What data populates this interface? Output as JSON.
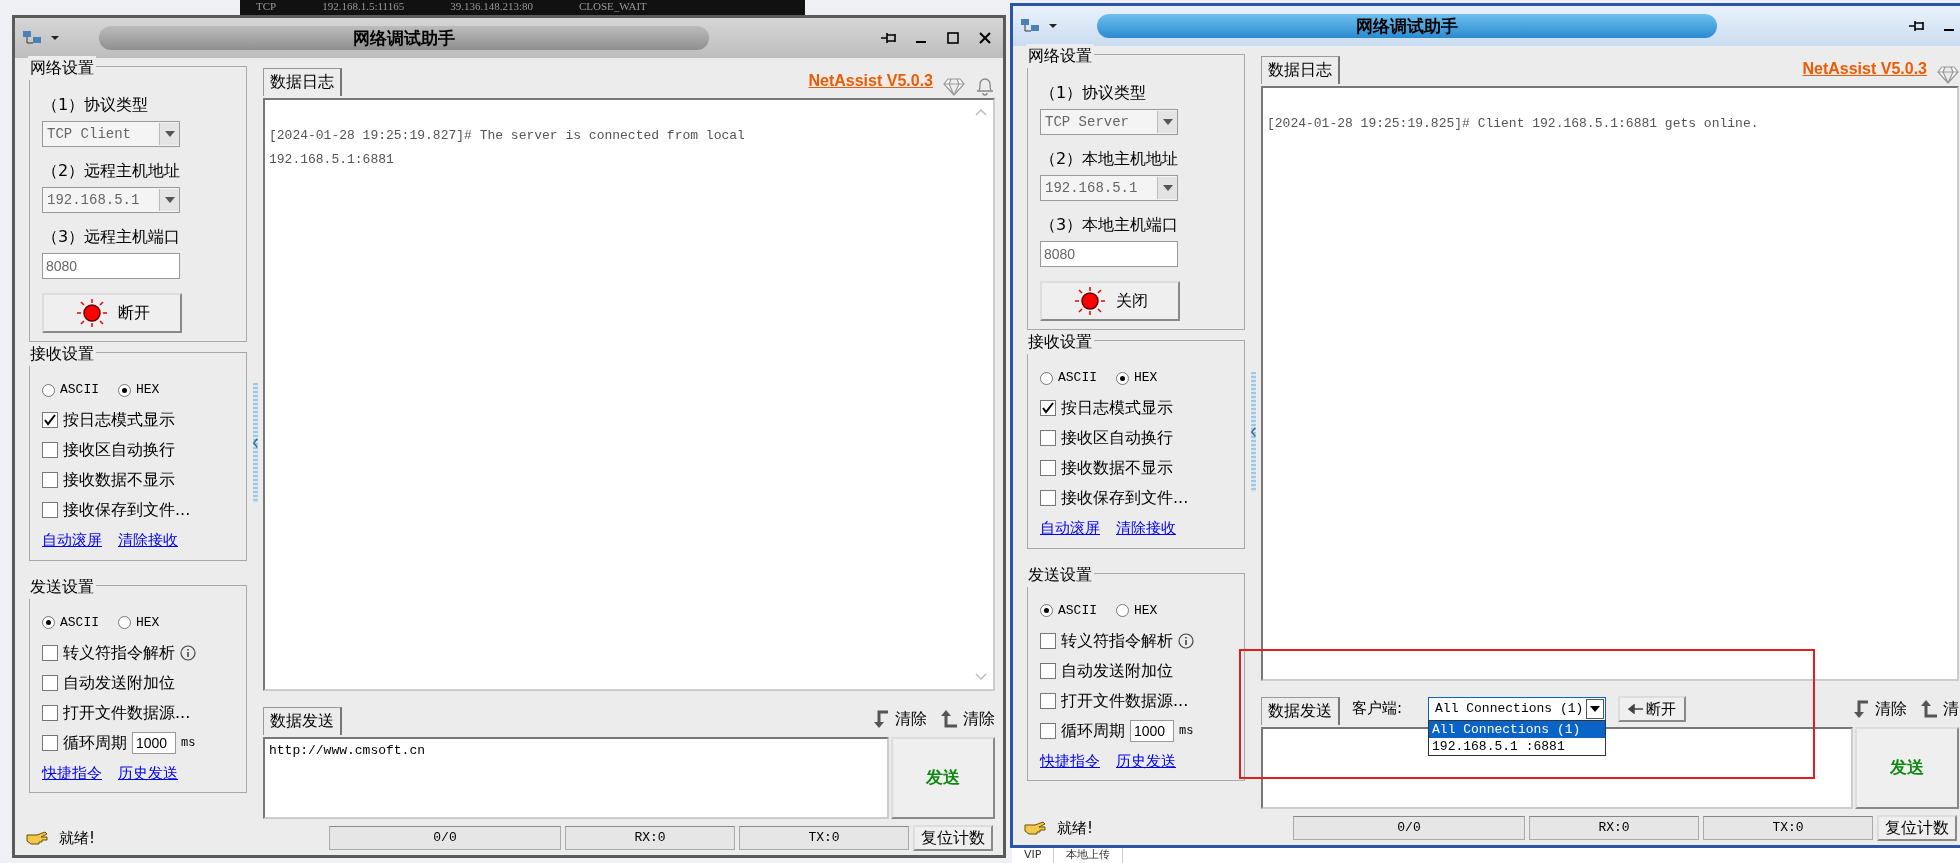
{
  "background": {
    "top_strip": [
      "TCP",
      "192.168.1.5:11165",
      "39.136.148.213:80",
      "CLOSE_WAIT"
    ],
    "bottom_strip": [
      "VIP",
      "本地上传"
    ]
  },
  "windows": [
    {
      "title": "网络调试助手",
      "active": false,
      "title_buttons": [
        {
          "kind": "pin"
        },
        {
          "kind": "minimize"
        },
        {
          "kind": "maximize"
        },
        {
          "kind": "close"
        }
      ],
      "network": {
        "title": "网络设置",
        "fields": [
          {
            "label": "（1）协议类型",
            "kind": "combo",
            "value": "TCP Client"
          },
          {
            "label": "（2）远程主机地址",
            "kind": "combo",
            "value": "192.168.5.1"
          },
          {
            "label": "（3）远程主机端口",
            "kind": "input",
            "value": "8080"
          }
        ],
        "button": "断开"
      },
      "receive": {
        "title": "接收设置",
        "options": [
          {
            "label": "ASCII",
            "selected": false
          },
          {
            "label": "HEX",
            "selected": true
          }
        ],
        "checks": [
          {
            "label": "按日志模式显示",
            "checked": true
          },
          {
            "label": "接收区自动换行",
            "checked": false
          },
          {
            "label": "接收数据不显示",
            "checked": false
          },
          {
            "label": "接收保存到文件...",
            "checked": false
          }
        ],
        "links": [
          "自动滚屏",
          "清除接收"
        ]
      },
      "send_settings": {
        "title": "发送设置",
        "options": [
          {
            "label": "ASCII",
            "selected": true
          },
          {
            "label": "HEX",
            "selected": false
          }
        ],
        "checks": [
          {
            "label": "转义符指令解析",
            "checked": false,
            "info": true
          },
          {
            "label": "自动发送附加位",
            "checked": false
          },
          {
            "label": "打开文件数据源...",
            "checked": false
          },
          {
            "label": "循环周期",
            "checked": false,
            "period": "1000",
            "unit": "ms"
          }
        ],
        "links": [
          "快捷指令",
          "历史发送"
        ]
      },
      "log_tab": "数据日志",
      "brand": "NetAssist V5.0.3",
      "header_icons": [
        {
          "kind": "diamond"
        },
        {
          "kind": "bell"
        }
      ],
      "log_scroll_arrows": true,
      "log_lines": [
        "[2024-01-28 19:25:19.827]# The server is connected from local",
        "192.168.5.1:6881"
      ],
      "send_tab": "数据发送",
      "clear_buttons": [
        "清除",
        "清除"
      ],
      "send_text": "http://www.cmsoft.cn",
      "send_button": "发送",
      "status": {
        "ready": "就绪!",
        "counts": [
          "0/0",
          "RX:0",
          "TX:0"
        ],
        "reset": "复位计数"
      }
    },
    {
      "title": "网络调试助手",
      "active": true,
      "title_buttons": [
        {
          "kind": "pin"
        },
        {
          "kind": "minimize"
        }
      ],
      "network": {
        "title": "网络设置",
        "fields": [
          {
            "label": "（1）协议类型",
            "kind": "combo",
            "value": "TCP Server"
          },
          {
            "label": "（2）本地主机地址",
            "kind": "combo",
            "value": "192.168.5.1"
          },
          {
            "label": "（3）本地主机端口",
            "kind": "input",
            "value": "8080"
          }
        ],
        "button": "关闭"
      },
      "receive": {
        "title": "接收设置",
        "options": [
          {
            "label": "ASCII",
            "selected": false
          },
          {
            "label": "HEX",
            "selected": true
          }
        ],
        "checks": [
          {
            "label": "按日志模式显示",
            "checked": true
          },
          {
            "label": "接收区自动换行",
            "checked": false
          },
          {
            "label": "接收数据不显示",
            "checked": false
          },
          {
            "label": "接收保存到文件...",
            "checked": false
          }
        ],
        "links": [
          "自动滚屏",
          "清除接收"
        ]
      },
      "send_settings": {
        "title": "发送设置",
        "options": [
          {
            "label": "ASCII",
            "selected": true
          },
          {
            "label": "HEX",
            "selected": false
          }
        ],
        "checks": [
          {
            "label": "转义符指令解析",
            "checked": false,
            "info": true
          },
          {
            "label": "自动发送附加位",
            "checked": false
          },
          {
            "label": "打开文件数据源...",
            "checked": false
          },
          {
            "label": "循环周期",
            "checked": false,
            "period": "1000",
            "unit": "ms"
          }
        ],
        "links": [
          "快捷指令",
          "历史发送"
        ]
      },
      "log_tab": "数据日志",
      "brand": "NetAssist V5.0.3",
      "header_icons": [
        {
          "kind": "diamond"
        }
      ],
      "log_scroll_arrows": false,
      "log_lines": [
        "[2024-01-28 19:25:19.825]# Client 192.168.5.1:6881 gets online."
      ],
      "send_tab": "数据发送",
      "client_selector": {
        "label": "客户端:",
        "value": "All Connections (1)",
        "disconnect": "断开",
        "expanded": true,
        "options": [
          {
            "label": "All Connections (1)",
            "selected": true
          },
          {
            "label": "192.168.5.1 :6881",
            "selected": false
          }
        ]
      },
      "clear_buttons": [
        "清除",
        "清"
      ],
      "send_button": "发送",
      "annotation": true,
      "status": {
        "ready": "就绪!",
        "counts": [
          "0/0",
          "RX:0",
          "TX:0"
        ],
        "reset": "复位计数"
      }
    }
  ]
}
